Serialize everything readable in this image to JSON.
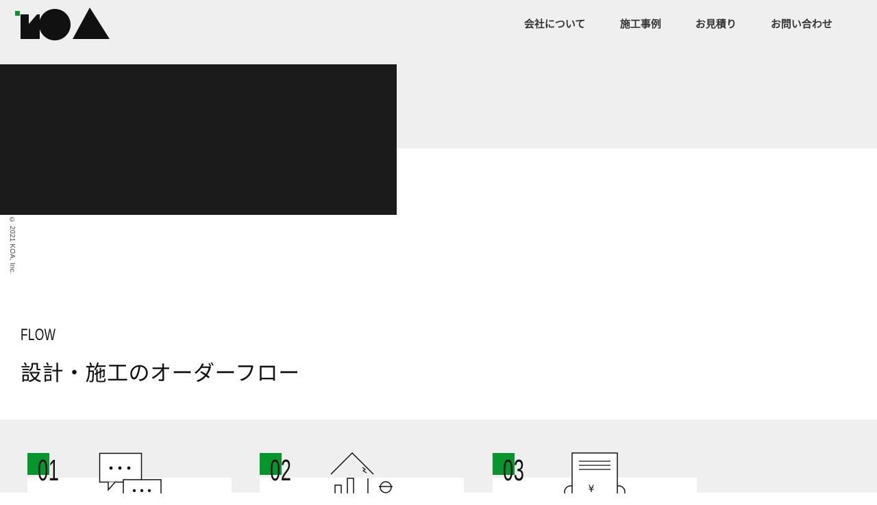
{
  "header": {
    "logo_text": "KOA",
    "nav": [
      {
        "label": "会社について"
      },
      {
        "label": "施工事例"
      },
      {
        "label": "お見積り"
      },
      {
        "label": "お問い合わせ"
      }
    ]
  },
  "copyright": "© 2021 KOA, Inc.",
  "flow": {
    "label": "FLOW",
    "title": "設計・施工のオーダーフロー",
    "steps": [
      {
        "number": "01",
        "icon": "chat-bubbles-icon"
      },
      {
        "number": "02",
        "icon": "house-worker-icon"
      },
      {
        "number": "03",
        "icon": "estimate-document-icon"
      }
    ]
  },
  "colors": {
    "accent_green": "#07962e",
    "hero_dark": "#1b1b1b",
    "band_gray": "#efefef"
  }
}
